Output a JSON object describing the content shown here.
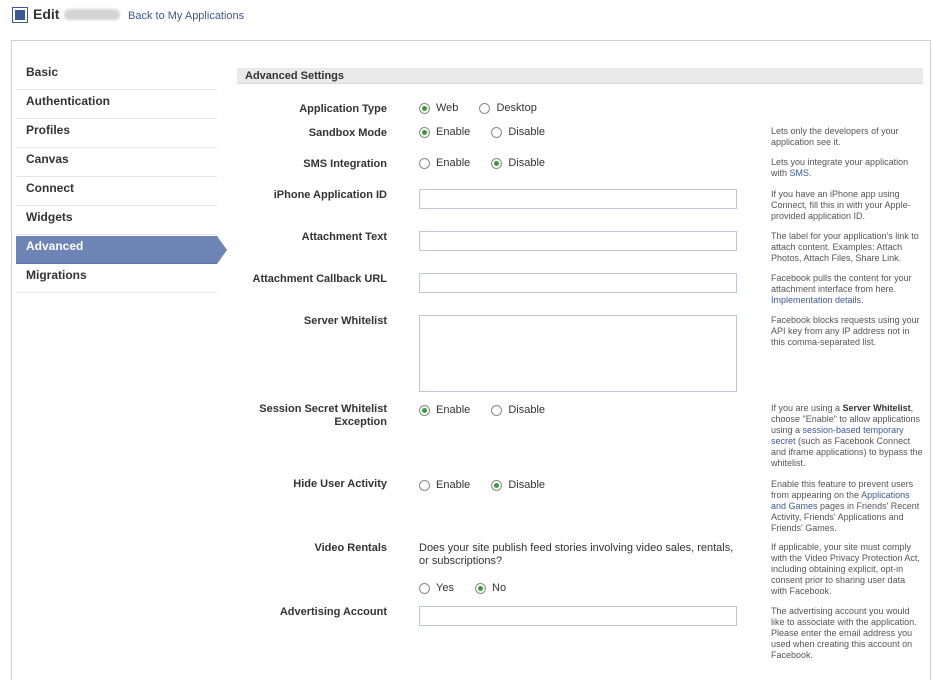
{
  "header": {
    "edit_label": "Edit",
    "back_link": "Back to My Applications"
  },
  "colors": {
    "accent": "#3b5998",
    "nav_active": "#6d84b4",
    "radio_on": "#3a9b3a"
  },
  "nav": {
    "items": [
      {
        "label": "Basic"
      },
      {
        "label": "Authentication"
      },
      {
        "label": "Profiles"
      },
      {
        "label": "Canvas"
      },
      {
        "label": "Connect"
      },
      {
        "label": "Widgets"
      },
      {
        "label": "Advanced"
      },
      {
        "label": "Migrations"
      }
    ],
    "active": "Advanced"
  },
  "section": {
    "title": "Advanced Settings"
  },
  "settings": {
    "app_type": {
      "label": "Application Type",
      "opt1": "Web",
      "opt2": "Desktop",
      "selected": "Web"
    },
    "sandbox": {
      "label": "Sandbox Mode",
      "opt1": "Enable",
      "opt2": "Disable",
      "selected": "Enable",
      "help": "Lets only the developers of your application see it."
    },
    "sms": {
      "label": "SMS Integration",
      "opt1": "Enable",
      "opt2": "Disable",
      "selected": "Disable",
      "help_pre": "Lets you integrate your application with ",
      "help_link": "SMS",
      "help_post": "."
    },
    "iphone": {
      "label": "iPhone Application ID",
      "value": "",
      "help": "If you have an iPhone app using Connect, fill this in with your Apple-provided application ID."
    },
    "attach_text": {
      "label": "Attachment Text",
      "value": "",
      "help": "The label for your application's link to attach content. Examples: Attach Photos, Attach Files, Share Link."
    },
    "attach_url": {
      "label": "Attachment Callback URL",
      "value": "",
      "help_pre": "Facebook pulls the content for your attachment interface from here. ",
      "help_link": "Implementation details",
      "help_post": "."
    },
    "server_whitelist": {
      "label": "Server Whitelist",
      "value": "",
      "help": "Facebook blocks requests using your API key from any IP address not in this comma-separated list."
    },
    "session_secret": {
      "label": "Session Secret Whitelist Exception",
      "opt1": "Enable",
      "opt2": "Disable",
      "selected": "Enable",
      "help_1": "If you are using a ",
      "help_bold": "Server Whitelist",
      "help_2": ", choose \"Enable\" to allow applications using a ",
      "help_link": "session-based temporary secret",
      "help_3": " (such as Facebook Connect and iframe applications) to bypass the whitelist."
    },
    "hide_activity": {
      "label": "Hide User Activity",
      "opt1": "Enable",
      "opt2": "Disable",
      "selected": "Disable",
      "help_1": "Enable this feature to prevent users from appearing on the ",
      "help_link": "Applications and Games",
      "help_2": " pages in Friends' Recent Activity, Friends' Applications and Friends' Games."
    },
    "video": {
      "label": "Video Rentals",
      "question": "Does your site publish feed stories involving video sales, rentals, or subscriptions?",
      "opt1": "Yes",
      "opt2": "No",
      "selected": "No",
      "help": "If applicable, your site must comply with the Video Privacy Protection Act, including obtaining explicit, opt-in consent prior to sharing user data with Facebook."
    },
    "ad_account": {
      "label": "Advertising Account",
      "value": "",
      "help": "The advertising account you would like to associate with the application. Please enter the email address you used when creating this account on Facebook."
    }
  }
}
